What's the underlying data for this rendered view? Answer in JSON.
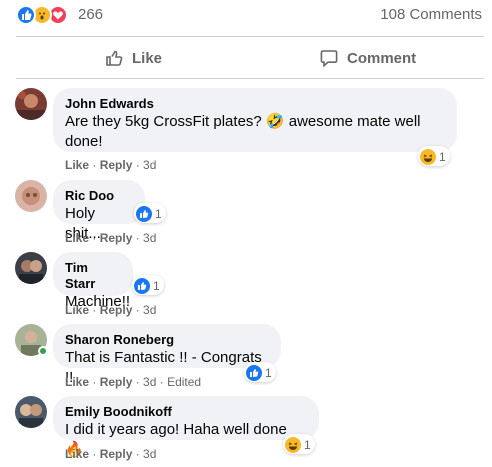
{
  "stats": {
    "reaction_count": "266",
    "comments_count": "108 Comments",
    "reaction_icons": [
      "like-icon",
      "wow-icon",
      "love-icon"
    ]
  },
  "actions": {
    "like_label": "Like",
    "comment_label": "Comment"
  },
  "comments": [
    {
      "author": "John Edwards",
      "text": "Are they 5kg CrossFit plates? 🤣 awesome mate well done!",
      "reaction": "haha-icon",
      "reaction_count": "1",
      "like": "Like",
      "reply": "Reply",
      "time": "3d",
      "edited": ""
    },
    {
      "author": "Ric Doo",
      "text": "Holy shit...",
      "reaction": "like-icon",
      "reaction_count": "1",
      "like": "Like",
      "reply": "Reply",
      "time": "3d",
      "edited": ""
    },
    {
      "author": "Tim Starr",
      "text": "Machine!!",
      "reaction": "like-icon",
      "reaction_count": "1",
      "like": "Like",
      "reply": "Reply",
      "time": "3d",
      "edited": ""
    },
    {
      "author": "Sharon Roneberg",
      "text": "That is Fantastic !! - Congrats !!",
      "reaction": "like-icon",
      "reaction_count": "1",
      "like": "Like",
      "reply": "Reply",
      "time": "3d",
      "edited": "Edited"
    },
    {
      "author": "Emily Boodnikoff",
      "text": "I did it years ago! Haha well done 🔥",
      "reaction": "haha-icon",
      "reaction_count": "1",
      "like": "Like",
      "reply": "Reply",
      "time": "3d",
      "edited": ""
    }
  ],
  "colors": {
    "like_blue": "#1877f2",
    "haha_yellow": "#f7b928",
    "love_red": "#f33e58",
    "bubble_bg": "#f0f2f5",
    "secondary_text": "#65676b",
    "online_green": "#31a24c"
  }
}
